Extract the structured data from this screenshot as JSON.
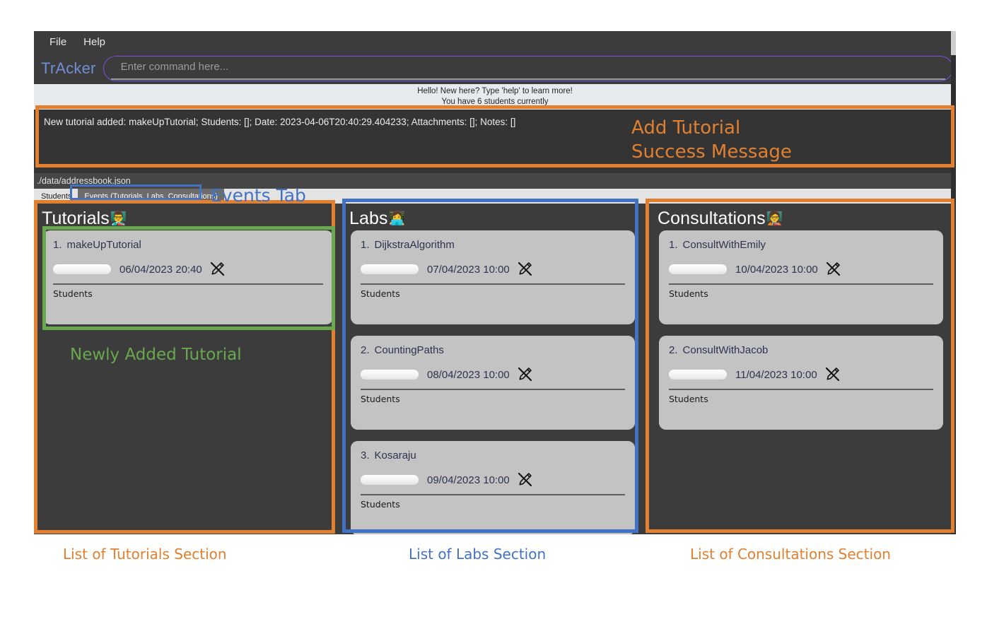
{
  "app": {
    "brand": "TrAcker",
    "menu": [
      "File",
      "Help"
    ],
    "command_placeholder": "Enter command here...",
    "command_value": "",
    "greeting_line1": "Hello! New here? Type 'help' to learn more!",
    "greeting_line2": "You have 6 students currently",
    "result_message": "New tutorial added: makeUpTutorial; Students: []; Date: 2023-04-06T20:40:29.404233; Attachments: []; Notes: []",
    "file_path": "./data/addressbook.json",
    "tabs": [
      {
        "label": "Students",
        "active": false
      },
      {
        "label": "Events (Tutorials, Labs, Consultations)",
        "active": true
      }
    ]
  },
  "panels": [
    {
      "key": "tutorials",
      "title": "Tutorials",
      "emoji": "👨‍🏫",
      "emoji_name": "teacher-icon",
      "cards": [
        {
          "index": "1.",
          "name": "makeUpTutorial",
          "date": "06/04/2023 20:40",
          "sub": "Students",
          "pen_icon": "pen-crossed-icon"
        }
      ]
    },
    {
      "key": "labs",
      "title": "Labs",
      "emoji": "👩‍💻",
      "emoji_name": "lab-computers-icon",
      "cards": [
        {
          "index": "1.",
          "name": "DijkstraAlgorithm",
          "date": "07/04/2023 10:00",
          "sub": "Students",
          "pen_icon": "pen-crossed-icon"
        },
        {
          "index": "2.",
          "name": "CountingPaths",
          "date": "08/04/2023 10:00",
          "sub": "Students",
          "pen_icon": "pen-crossed-icon"
        },
        {
          "index": "3.",
          "name": "Kosaraju",
          "date": "09/04/2023 10:00",
          "sub": "Students",
          "pen_icon": "pen-crossed-icon"
        }
      ]
    },
    {
      "key": "consultations",
      "title": "Consultations",
      "emoji": "🧑‍🏫",
      "emoji_name": "consultation-icon",
      "cards": [
        {
          "index": "1.",
          "name": "ConsultWithEmily",
          "date": "10/04/2023 10:00",
          "sub": "Students",
          "pen_icon": "pen-crossed-icon"
        },
        {
          "index": "2.",
          "name": "ConsultWithJacob",
          "date": "11/04/2023 10:00",
          "sub": "Students",
          "pen_icon": "pen-crossed-icon"
        }
      ]
    }
  ],
  "annotations": {
    "colors": {
      "orange": "#E08030",
      "green": "#6AA84F",
      "blue": "#4372C4"
    },
    "labels": [
      {
        "id": "add-tutorial-success-message",
        "text": "Add Tutorial\nSuccess Message",
        "color": "#E08030"
      },
      {
        "id": "events-tab",
        "text": "Events Tab",
        "color": "#4372C4"
      },
      {
        "id": "newly-added-tutorial",
        "text": "Newly Added Tutorial",
        "color": "#6AA84F"
      },
      {
        "id": "list-of-tutorials-section",
        "text": "List of Tutorials Section",
        "color": "#E08030"
      },
      {
        "id": "list-of-labs-section",
        "text": "List of Labs Section",
        "color": "#4372C4"
      },
      {
        "id": "list-of-consultations-section",
        "text": "List of Consultations Section",
        "color": "#E08030"
      }
    ]
  }
}
